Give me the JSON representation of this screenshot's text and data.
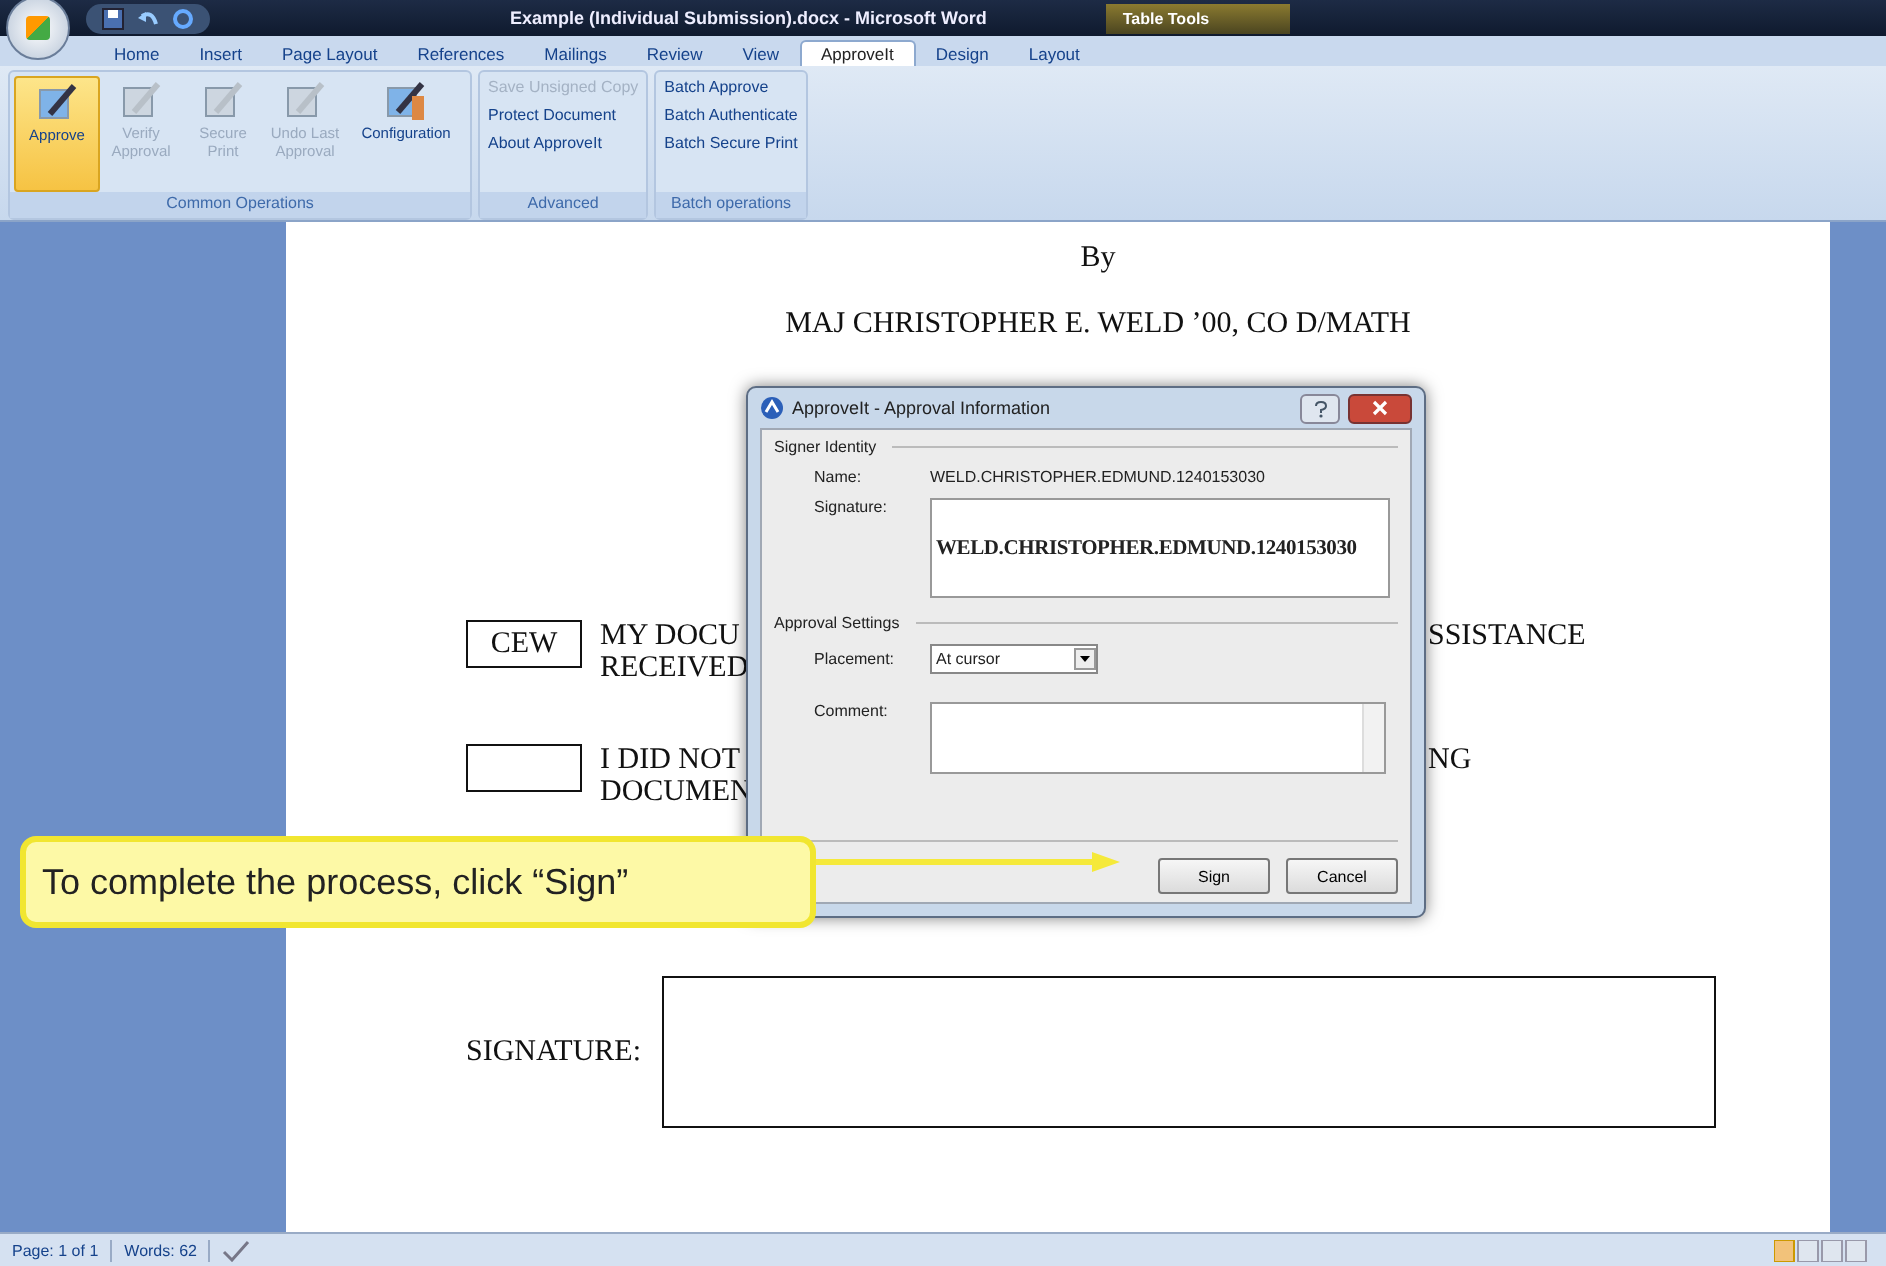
{
  "window": {
    "title": "Example (Individual Submission).docx - Microsoft Word",
    "context_tab": "Table Tools"
  },
  "tabs": [
    {
      "label": "Home",
      "selected": false
    },
    {
      "label": "Insert",
      "selected": false
    },
    {
      "label": "Page Layout",
      "selected": false
    },
    {
      "label": "References",
      "selected": false
    },
    {
      "label": "Mailings",
      "selected": false
    },
    {
      "label": "Review",
      "selected": false
    },
    {
      "label": "View",
      "selected": false
    },
    {
      "label": "ApproveIt",
      "selected": true
    },
    {
      "label": "Design",
      "selected": false
    },
    {
      "label": "Layout",
      "selected": false
    }
  ],
  "ribbon": {
    "groups": [
      {
        "label": "Common Operations",
        "kind": "large",
        "buttons": [
          {
            "label": "Approve",
            "selected": true,
            "disabled": false
          },
          {
            "label": "Verify Approval",
            "selected": false,
            "disabled": true
          },
          {
            "label": "Secure Print",
            "selected": false,
            "disabled": true
          },
          {
            "label": "Undo Last Approval",
            "selected": false,
            "disabled": true
          },
          {
            "label": "Configuration",
            "selected": false,
            "disabled": false
          }
        ]
      },
      {
        "label": "Advanced",
        "kind": "small",
        "buttons": [
          {
            "label": "Save Unsigned Copy",
            "disabled": true
          },
          {
            "label": "Protect Document",
            "disabled": false
          },
          {
            "label": "About ApproveIt",
            "disabled": false
          }
        ]
      },
      {
        "label": "Batch operations",
        "kind": "small",
        "buttons": [
          {
            "label": "Batch Approve",
            "disabled": false
          },
          {
            "label": "Batch Authenticate",
            "disabled": false
          },
          {
            "label": "Batch Secure Print",
            "disabled": false
          }
        ]
      }
    ]
  },
  "document": {
    "lines": [
      "By",
      "MAJ CHRISTOPHER E. WELD ’00, CO D/MATH"
    ],
    "statements": [
      {
        "box_text": "CEW",
        "left_lines": [
          "MY DOCU",
          "RECEIVED"
        ],
        "right_text": "SSISTANCE"
      },
      {
        "left_lines": [
          "I DID NOT",
          "DOCUMEN"
        ],
        "right_text": "NG"
      }
    ],
    "signature_label": "SIGNATURE:"
  },
  "dialog": {
    "title": "ApproveIt - Approval Information",
    "signer_identity_label": "Signer Identity",
    "name_label": "Name:",
    "name_value": "WELD.CHRISTOPHER.EDMUND.1240153030",
    "signature_label": "Signature:",
    "signature_value": "WELD.CHRISTOPHER.EDMUND.1240153030",
    "approval_settings_label": "Approval Settings",
    "placement_label": "Placement:",
    "placement_value": "At cursor",
    "comment_label": "Comment:",
    "buttons": [
      "Sign",
      "Cancel"
    ]
  },
  "callout": {
    "text": "To complete the process, click “Sign”"
  },
  "status_bar": {
    "page": "Page: 1 of 1",
    "words": "Words: 62"
  }
}
